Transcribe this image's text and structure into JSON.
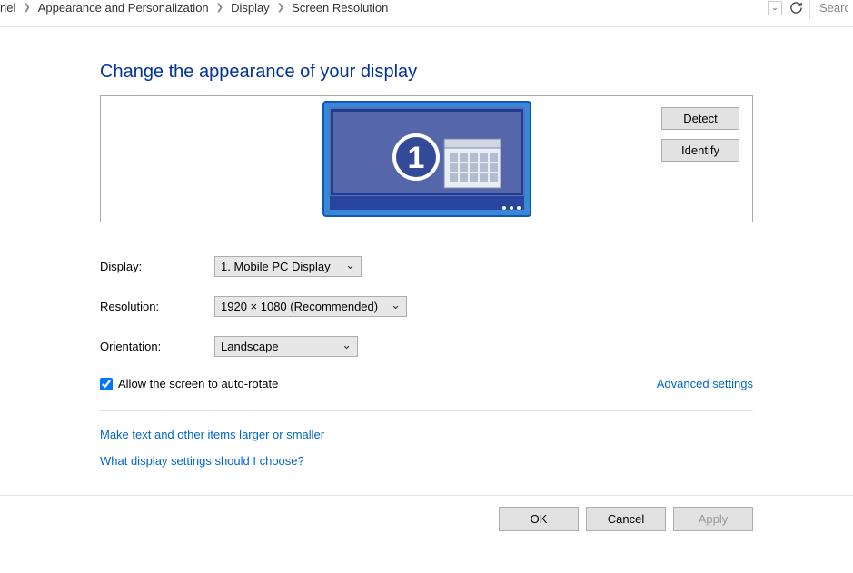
{
  "breadcrumb": {
    "items": [
      "nel",
      "Appearance and Personalization",
      "Display",
      "Screen Resolution"
    ]
  },
  "search": {
    "placeholder": "Searc"
  },
  "page": {
    "title": "Change the appearance of your display"
  },
  "preview": {
    "detect": "Detect",
    "identify": "Identify",
    "monitor_number": "1"
  },
  "form": {
    "display_label": "Display:",
    "display_value": "1. Mobile PC Display",
    "resolution_label": "Resolution:",
    "resolution_value": "1920 × 1080 (Recommended)",
    "orientation_label": "Orientation:",
    "orientation_value": "Landscape"
  },
  "options": {
    "autorotate": "Allow the screen to auto-rotate",
    "advanced": "Advanced settings"
  },
  "help": {
    "scale": "Make text and other items larger or smaller",
    "which": "What display settings should I choose?"
  },
  "footer": {
    "ok": "OK",
    "cancel": "Cancel",
    "apply": "Apply"
  }
}
